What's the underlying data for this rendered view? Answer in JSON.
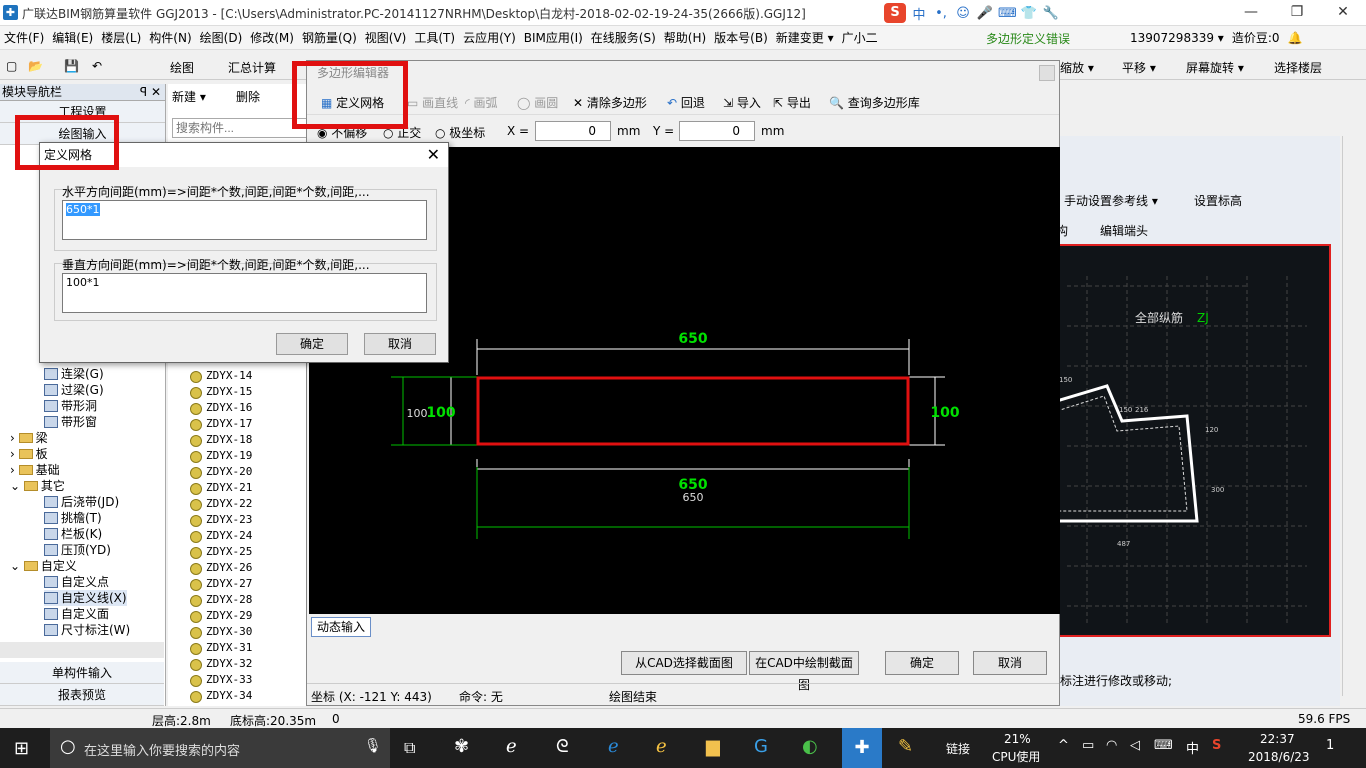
{
  "window": {
    "title": "广联达BIM钢筋算量软件 GGJ2013 - [C:\\Users\\Administrator.PC-20141127NRHM\\Desktop\\白龙村-2018-02-02-19-24-35(2666版).GGJ12]",
    "controls": [
      "—",
      "❐",
      "✕"
    ]
  },
  "ime": {
    "brand": "S",
    "items": [
      "中",
      "•,",
      "☺",
      "🎤",
      "⌨",
      "👕",
      "🔧"
    ]
  },
  "menu": {
    "items": [
      "文件(F)",
      "编辑(E)",
      "楼层(L)",
      "构件(N)",
      "绘图(D)",
      "修改(M)",
      "钢筋量(Q)",
      "视图(V)",
      "工具(T)",
      "云应用(Y)",
      "BIM应用(I)",
      "在线服务(S)",
      "帮助(H)",
      "版本号(B)",
      "新建变更 ▾",
      "广小二"
    ],
    "error_text": "多边形定义错误",
    "phone": "13907298339 ▾",
    "price": "造价豆:0",
    "bell": "🔔"
  },
  "toolbar": {
    "draw": "绘图",
    "sum": "汇总计算",
    "right": [
      "缩放 ▾",
      "平移 ▾",
      "屏幕旋转 ▾",
      "选择楼层"
    ]
  },
  "nav": {
    "title": "模块导航栏",
    "pin": "ꟼ ✕",
    "project": "工程设置",
    "draw_input": "绘图输入",
    "tree": [
      {
        "label": "连梁(G)",
        "kind": "leaf"
      },
      {
        "label": "过梁(G)",
        "kind": "leaf"
      },
      {
        "label": "带形洞",
        "kind": "leaf"
      },
      {
        "label": "带形窗",
        "kind": "leaf"
      },
      {
        "label": "梁",
        "kind": "folder"
      },
      {
        "label": "板",
        "kind": "folder"
      },
      {
        "label": "基础",
        "kind": "folder"
      },
      {
        "label": "其它",
        "kind": "folder"
      },
      {
        "label": "后浇带(JD)",
        "kind": "leaf"
      },
      {
        "label": "挑檐(T)",
        "kind": "leaf"
      },
      {
        "label": "栏板(K)",
        "kind": "leaf"
      },
      {
        "label": "压顶(YD)",
        "kind": "leaf"
      },
      {
        "label": "自定义",
        "kind": "folder"
      },
      {
        "label": "自定义点",
        "kind": "leaf"
      },
      {
        "label": "自定义线(X)",
        "kind": "leaf"
      },
      {
        "label": "自定义面",
        "kind": "leaf"
      },
      {
        "label": "尺寸标注(W)",
        "kind": "leaf"
      }
    ],
    "single": "单构件输入",
    "report": "报表预览"
  },
  "components": {
    "new": "新建 ▾",
    "delete": "删除",
    "search_placeholder": "搜索构件...",
    "items": [
      "ZDYX-14",
      "ZDYX-15",
      "ZDYX-16",
      "ZDYX-17",
      "ZDYX-18",
      "ZDYX-19",
      "ZDYX-20",
      "ZDYX-21",
      "ZDYX-22",
      "ZDYX-23",
      "ZDYX-24",
      "ZDYX-25",
      "ZDYX-26",
      "ZDYX-27",
      "ZDYX-28",
      "ZDYX-29",
      "ZDYX-30",
      "ZDYX-31",
      "ZDYX-32",
      "ZDYX-33",
      "ZDYX-34"
    ]
  },
  "background": {
    "tb1": [
      "手动设置参考线 ▾",
      "设置标高"
    ],
    "tb2": [
      "构",
      "编辑端头"
    ],
    "label_all": "全部纵筋",
    "label_zj": "ZJ",
    "dims": [
      "150",
      "150",
      "216",
      "120",
      "300",
      "487"
    ],
    "status_tail": "择标注进行修改或移动;"
  },
  "editor": {
    "title": "多边形编辑器",
    "tools": [
      "定义网格",
      "画直线",
      "画弧",
      "画圆",
      "清除多边形",
      "回退",
      "导入",
      "导出",
      "查询多边形库"
    ],
    "modes": [
      "不偏移",
      "正交",
      "极坐标"
    ],
    "x_label": "X =",
    "x_value": "0",
    "y_label": "Y =",
    "y_value": "0",
    "unit": "mm",
    "dims": {
      "top": "650",
      "bottom": "650",
      "bottom_small": "650",
      "left": "100",
      "left_small": "100",
      "right": "100"
    },
    "dynamic_input": "动态输入",
    "btn_cad_select": "从CAD选择截面图",
    "btn_cad_draw": "在CAD中绘制截面图",
    "btn_ok": "确定",
    "btn_cancel": "取消",
    "coord": "坐标 (X: -121 Y: 443)",
    "command": "命令: 无",
    "draw_end": "绘图结束"
  },
  "dialog": {
    "title": "定义网格",
    "h_label": "水平方向间距(mm)=>间距*个数,间距,间距*个数,间距,...",
    "h_value": "650*1",
    "v_label": "垂直方向间距(mm)=>间距*个数,间距,间距*个数,间距,...",
    "v_value": "100*1",
    "ok": "确定",
    "cancel": "取消"
  },
  "statusbar": {
    "floor_height": "层高:2.8m",
    "base_height": "底标高:20.35m",
    "zero": "0",
    "fps": "59.6 FPS"
  },
  "taskbar": {
    "search_placeholder": "在这里输入你要搜索的内容",
    "link": "链接",
    "cpu_percent": "21%",
    "cpu_label": "CPU使用",
    "lang": "中",
    "time": "22:37",
    "date": "2018/6/23",
    "notify": "1"
  },
  "colors": {
    "accent_red": "#e01010",
    "dim_green": "#00e000",
    "highlight_blue": "#3399ff"
  }
}
